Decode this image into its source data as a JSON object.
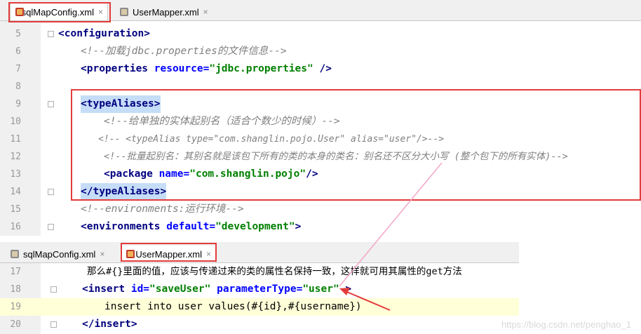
{
  "top_editor": {
    "tabs": [
      {
        "label": "sqlMapConfig.xml",
        "close": "×"
      },
      {
        "label": "UserMapper.xml",
        "close": "×"
      }
    ],
    "lines": [
      {
        "n": "5",
        "code": "<configuration>"
      },
      {
        "n": "6",
        "code": "<!--加载jdbc.properties的文件信息-->"
      },
      {
        "n": "7",
        "tag_open": "<properties ",
        "attr": "resource=",
        "val": "\"jdbc.properties\"",
        "tag_close": " />"
      },
      {
        "n": "8",
        "code": ""
      },
      {
        "n": "9",
        "code": "<typeAliases>"
      },
      {
        "n": "10",
        "code": "<!--给单独的实体起别名（适合个数少的时候）-->"
      },
      {
        "n": "11",
        "code": "<!-- <typeAlias type=\"com.shanglin.pojo.User\" alias=\"user\"/>-->"
      },
      {
        "n": "12",
        "code": "<!--批量起别名：其别名就是该包下所有的类的本身的类名：别名还不区分大小写 (整个包下的所有实体)-->"
      },
      {
        "n": "13",
        "tag_open": "<package ",
        "attr": "name=",
        "val": "\"com.shanglin.pojo\"",
        "tag_close": "/>"
      },
      {
        "n": "14",
        "code": "</typeAliases>"
      },
      {
        "n": "15",
        "code": "<!--environments:运行环境-->"
      },
      {
        "n": "16",
        "tag_open": "<environments ",
        "attr": "default=",
        "val": "\"development\"",
        "tag_close": ">"
      }
    ]
  },
  "bottom_editor": {
    "tabs": [
      {
        "label": "sqlMapConfig.xml",
        "close": "×"
      },
      {
        "label": "UserMapper.xml",
        "close": "×"
      }
    ],
    "lines": [
      {
        "n": "17",
        "code": "那么#{}里面的值，应该与传递过来的类的属性名保持一致，这样就可用其属性的get方法"
      },
      {
        "n": "18",
        "tag_open": "<insert ",
        "attr1": "id=",
        "val1": "\"saveUser\"",
        "attr2": " parameterType=",
        "val2": "\"user\"",
        "tag_close": " >"
      },
      {
        "n": "19",
        "code": "insert into user values(#{id},#{username})"
      },
      {
        "n": "20",
        "code": "</insert>"
      }
    ]
  },
  "watermark": "https://blog.csdn.net/penghao_1",
  "colors": {
    "annotation_red": "#e33b3b",
    "connector_pink": "#f3a6c8",
    "current_line": "#ffffd8"
  }
}
